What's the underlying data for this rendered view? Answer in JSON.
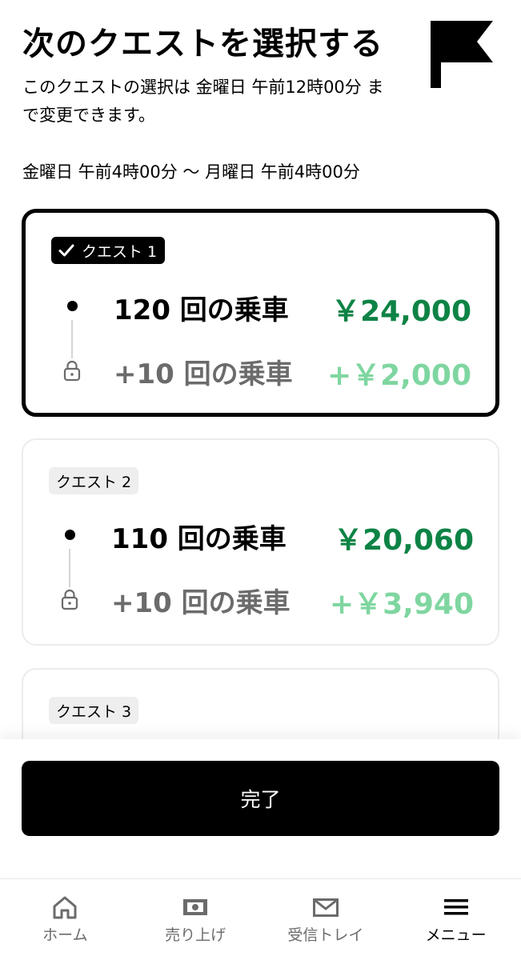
{
  "header": {
    "title": "次のクエストを選択する",
    "subtitle": "このクエストの選択は 金曜日 午前12時00分 まで変更できます。",
    "range": "金曜日 午前4時00分 〜 月曜日 午前4時00分",
    "flag_icon": "flag-icon"
  },
  "quests": [
    {
      "badge": "クエスト 1",
      "selected": true,
      "base_rides": "120 回の乗車",
      "base_amount": "￥24,000",
      "bonus_rides": "+10 回の乗車",
      "bonus_amount": "+￥2,000"
    },
    {
      "badge": "クエスト 2",
      "selected": false,
      "base_rides": "110 回の乗車",
      "base_amount": "￥20,060",
      "bonus_rides": "+10 回の乗車",
      "bonus_amount": "+￥3,940"
    },
    {
      "badge": "クエスト 3",
      "selected": false
    }
  ],
  "done_button": "完了",
  "nav": [
    {
      "label": "ホーム",
      "icon": "home-icon",
      "active": false
    },
    {
      "label": "売り上げ",
      "icon": "earnings-icon",
      "active": false
    },
    {
      "label": "受信トレイ",
      "icon": "mail-icon",
      "active": false
    },
    {
      "label": "メニュー",
      "icon": "menu-icon",
      "active": true
    }
  ],
  "colors": {
    "primary_amount": "#0e8345",
    "bonus_amount": "#7fd6a0",
    "button_bg": "#000000"
  }
}
